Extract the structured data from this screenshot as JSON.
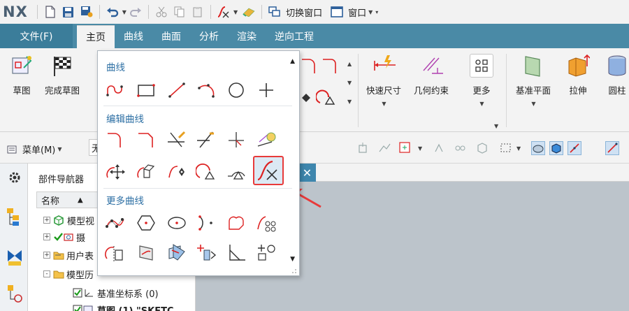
{
  "app": {
    "logo": "NX"
  },
  "quick_access": {
    "switch_window": "切换窗口",
    "window": "窗口"
  },
  "tabs": {
    "file": "文件(F)",
    "items": [
      "主页",
      "曲线",
      "曲面",
      "分析",
      "渲染",
      "逆向工程"
    ],
    "active_index": 0
  },
  "ribbon": {
    "sketch": "草图",
    "finish_sketch": "完成草图",
    "rapid_dimension": "快速尺寸",
    "geometric_constraints": "几何约束",
    "more": "更多",
    "datum_plane": "基准平面",
    "extrude": "拉伸",
    "cylinder": "圆柱"
  },
  "toolbar2": {
    "menu": "菜单(M)",
    "combo_value": "无"
  },
  "navigator": {
    "title": "部件导航器",
    "column_name": "名称",
    "rows": [
      {
        "label": "模型视",
        "expander": "+"
      },
      {
        "label": "摄",
        "expander": "+"
      },
      {
        "label": "用户表",
        "expander": "+"
      },
      {
        "label": "模型历",
        "expander": "-"
      },
      {
        "label": "基准坐标系 (0)",
        "expander": ""
      },
      {
        "label": "草图 (1) \"SKETC",
        "expander": ""
      }
    ]
  },
  "gallery": {
    "sections": [
      "曲线",
      "编辑曲线",
      "更多曲线"
    ],
    "curve_icons": [
      "arc-curve-icon",
      "rectangle-icon",
      "line-icon",
      "three-point-arc-icon",
      "circle-icon",
      "point-icon"
    ],
    "edit_icons_row1": [
      "fillet-icon",
      "chamfer-icon",
      "quick-trim-icon",
      "quick-extend-icon",
      "make-corner-icon",
      "derived-lines-icon"
    ],
    "edit_icons_row2": [
      "move-curve-icon",
      "offset-move-curve-icon",
      "resize-curve-icon",
      "resize-chamfer-curve-icon",
      "delete-curve-icon",
      "trim-recipe-curve-icon"
    ],
    "more_icons_row1": [
      "studio-spline-icon",
      "polygon-icon",
      "ellipse-icon",
      "conic-icon",
      "fillet-loop-icon",
      "pattern-curve-icon"
    ],
    "more_icons_row2": [
      "mirror-curve-icon",
      "project-curve-icon",
      "intersection-curve-icon",
      "add-existing-curves-icon",
      "trim-corner-icon",
      "point-and-circle-icon"
    ],
    "selected_icon": "trim-recipe-curve-icon"
  },
  "colors": {
    "tab_bar": "#4a8aa6",
    "accent_blue": "#2b6ea3",
    "highlight_red": "#e83a3a",
    "graphics_bg": "#bcc4cb"
  }
}
